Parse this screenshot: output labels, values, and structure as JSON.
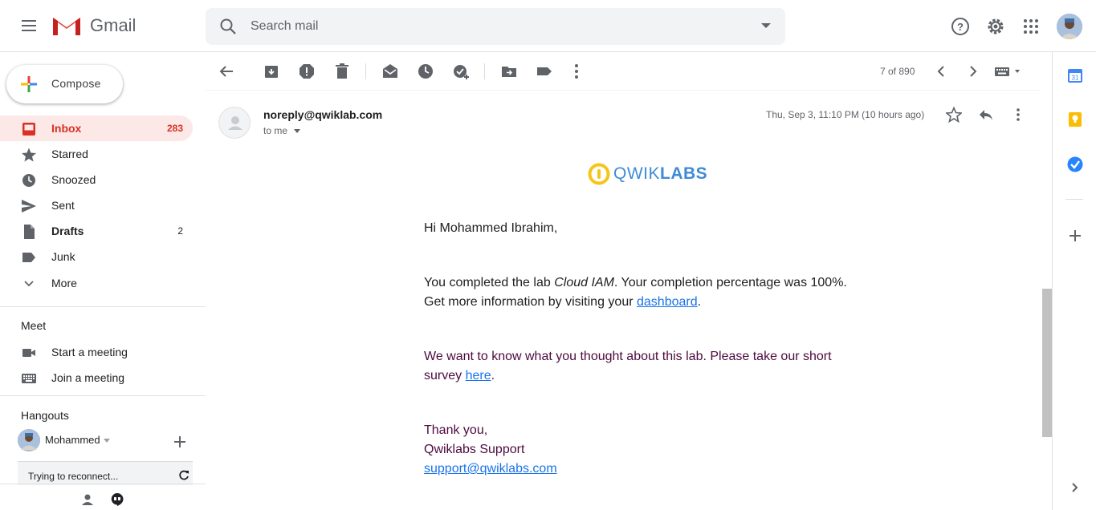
{
  "app": {
    "name": "Gmail"
  },
  "search": {
    "placeholder": "Search mail"
  },
  "compose": {
    "label": "Compose"
  },
  "nav": [
    {
      "label": "Inbox",
      "count": "283"
    },
    {
      "label": "Starred",
      "count": ""
    },
    {
      "label": "Snoozed",
      "count": ""
    },
    {
      "label": "Sent",
      "count": ""
    },
    {
      "label": "Drafts",
      "count": "2"
    },
    {
      "label": "Junk",
      "count": ""
    },
    {
      "label": "More",
      "count": ""
    }
  ],
  "meet": {
    "title": "Meet",
    "items": [
      "Start a meeting",
      "Join a meeting"
    ]
  },
  "hangouts": {
    "title": "Hangouts",
    "user": "Mohammed",
    "status": "Trying to reconnect..."
  },
  "pager": {
    "text": "7 of 890"
  },
  "message": {
    "sender": "noreply@qwiklab.com",
    "to": "to me",
    "date": "Thu, Sep 3, 11:10 PM (10 hours ago)",
    "brand_a": "QWIK",
    "brand_b": "LABS",
    "greeting": "Hi Mohammed Ibrahim,",
    "p1_a": "You completed the lab ",
    "p1_lab": "Cloud IAM",
    "p1_b": ". Your completion percentage was 100%.",
    "p1_c": "Get more information by visiting your ",
    "p1_link": "dashboard",
    "p1_d": ".",
    "p2_a": "We want to know what you thought about this lab. Please take our short",
    "p2_b": "survey ",
    "p2_link": "here",
    "p2_c": ".",
    "thanks": "Thank you,",
    "team": "Qwiklabs Support",
    "support_email": "support@qwiklabs.com"
  },
  "colors": {
    "accent_red": "#d93025",
    "active_bg": "#fce8e6",
    "link": "#1a73e8",
    "purple_text": "#4d0a3e"
  }
}
